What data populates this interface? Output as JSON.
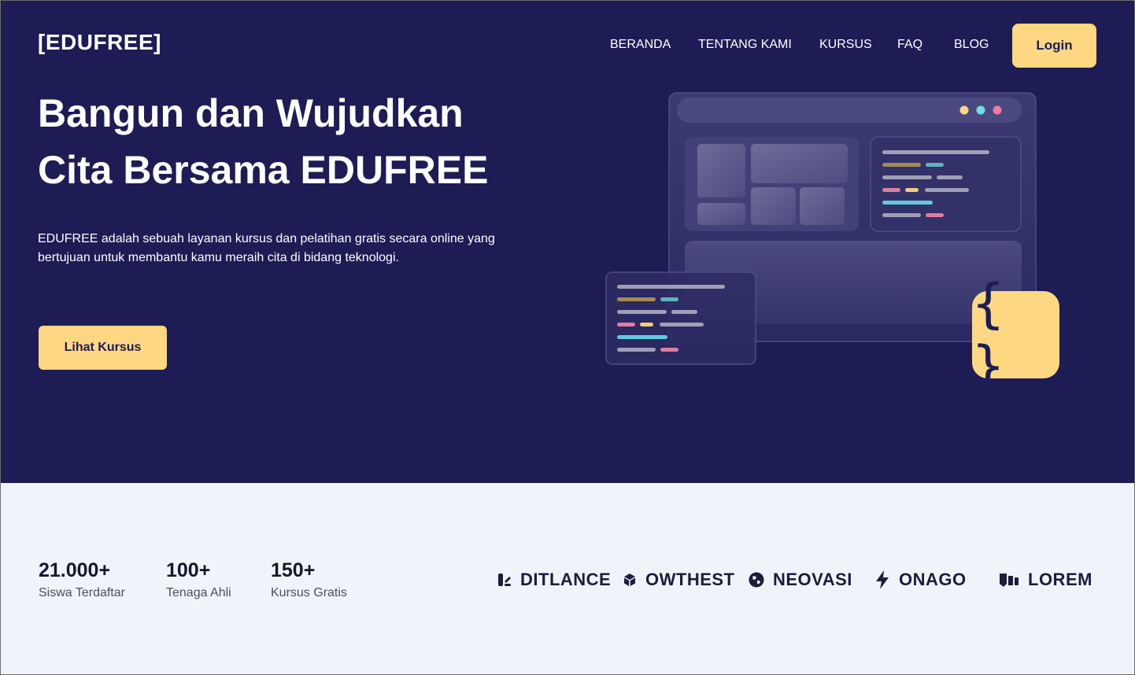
{
  "header": {
    "logo": "[EDUFREE]",
    "nav": [
      "BERANDA",
      "TENTANG KAMI",
      "KURSUS",
      "FAQ",
      "BLOG"
    ],
    "login_label": "Login"
  },
  "hero": {
    "headline_line1": "Bangun dan Wujudkan",
    "headline_line2": "Cita Bersama EDUFREE",
    "description_line1": "EDUFREE adalah sebuah layanan kursus dan pelatihan gratis secara online yang",
    "description_line2": "bertujuan untuk membantu kamu meraih cita di bidang teknologi.",
    "cta_label": "Lihat Kursus",
    "code_icon": "{ }"
  },
  "stats": [
    {
      "value": "21.000+",
      "label": "Siswa Terdaftar"
    },
    {
      "value": "100+",
      "label": "Tenaga Ahli"
    },
    {
      "value": "150+",
      "label": "Kursus Gratis"
    }
  ],
  "brands": [
    {
      "name": "DITLANCE",
      "icon": "ditlance-icon"
    },
    {
      "name": "OWTHEST",
      "icon": "cube-icon"
    },
    {
      "name": "NEOVASI",
      "icon": "globe-icon"
    },
    {
      "name": "ONAGO",
      "icon": "bolt-icon"
    },
    {
      "name": "LOREM",
      "icon": "lorem-icon"
    }
  ],
  "colors": {
    "hero_bg": "#1e1c55",
    "accent": "#fdd782",
    "lower_bg": "#eff4fb"
  }
}
